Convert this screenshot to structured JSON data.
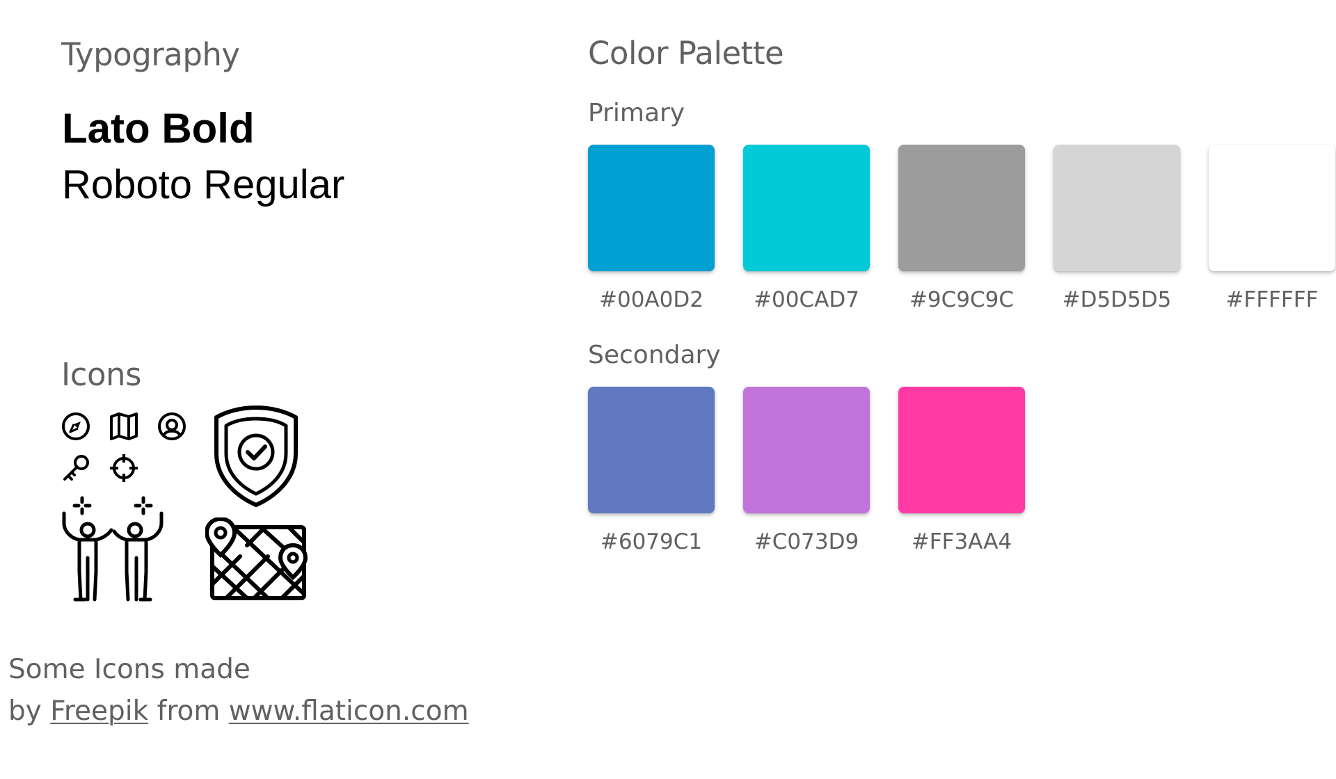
{
  "typography": {
    "title": "Typography",
    "font_primary": "Lato Bold",
    "font_secondary": "Roboto Regular"
  },
  "icons": {
    "title": "Icons",
    "list": [
      "navigation-icon",
      "map-icon",
      "user-circle-icon",
      "key-icon",
      "crosshair-icon",
      "shield-check-icon",
      "people-celebrating-icon",
      "map-pins-icon"
    ]
  },
  "credit": {
    "line1": "Some Icons made",
    "by": "by",
    "author_link": "Freepik",
    "from": "from",
    "site_link": "www.flaticon.com"
  },
  "palette": {
    "title": "Color Palette",
    "primary_title": "Primary",
    "primary": [
      {
        "label": "#00A0D2",
        "color": "#00A0D2"
      },
      {
        "label": "#00CAD7",
        "color": "#00CAD7"
      },
      {
        "label": "#9C9C9C",
        "color": "#9C9C9C"
      },
      {
        "label": "#D5D5D5",
        "color": "#D5D5D5"
      },
      {
        "label": "#FFFFFF",
        "color": "#FFFFFF"
      }
    ],
    "secondary_title": "Secondary",
    "secondary": [
      {
        "label": "#6079C1",
        "color": "#6079C1"
      },
      {
        "label": "#C073D9",
        "color": "#C073D9"
      },
      {
        "label": "#FF3AA4",
        "color": "#FF3AA4"
      }
    ]
  }
}
